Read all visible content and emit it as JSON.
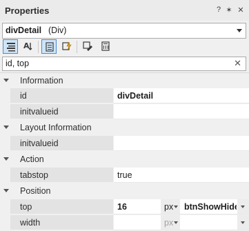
{
  "panel": {
    "title": "Properties",
    "buttons": {
      "help": "?",
      "pin": "✶",
      "close": "✕"
    }
  },
  "object_selector": {
    "name": "divDetail",
    "type": "(Div)"
  },
  "toolbar": {
    "icons": [
      "categorized-icon",
      "alphabetical-icon",
      "properties-view-icon",
      "events-view-icon",
      "edit-icon",
      "script-icon"
    ]
  },
  "search": {
    "value": "id, top",
    "clear": "✕"
  },
  "grid": {
    "information": {
      "label": "Information",
      "rows": [
        {
          "name": "id",
          "value": "divDetail"
        },
        {
          "name": "initvalueid",
          "value": ""
        }
      ]
    },
    "layout": {
      "label": "Layout Information",
      "rows": [
        {
          "name": "initvalueid",
          "value": ""
        }
      ]
    },
    "action": {
      "label": "Action",
      "rows": [
        {
          "name": "tabstop",
          "value": "true"
        }
      ]
    },
    "position": {
      "label": "Position",
      "top": {
        "name": "top",
        "value": "16",
        "unit": "px",
        "ref": "btnShowHide"
      },
      "width": {
        "name": "width",
        "value": "",
        "unit": "px",
        "ref": ""
      }
    }
  }
}
